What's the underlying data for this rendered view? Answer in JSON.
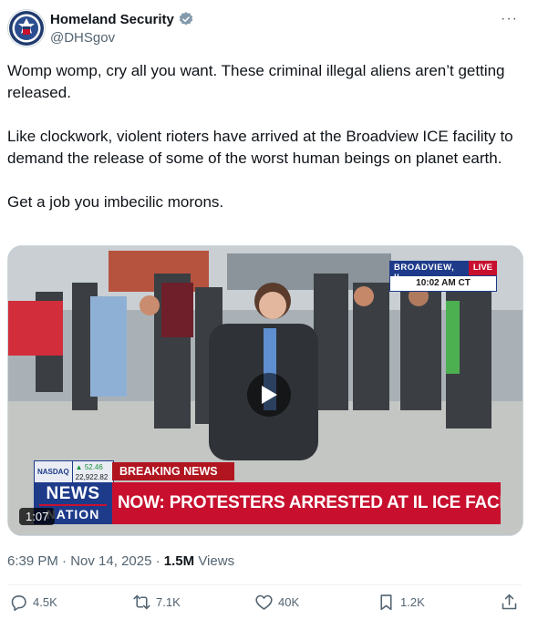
{
  "account": {
    "display_name": "Homeland Security",
    "handle": "@DHSgov",
    "verified_icon": "verified-badge-icon",
    "more_label": "···"
  },
  "tweet": {
    "paragraphs": [
      "Womp womp, cry all you want. These criminal illegal aliens aren’t getting released.",
      "Like clockwork, violent rioters have arrived at the Broadview ICE facility to demand the release of some of the worst human beings on planet earth.",
      "Get a job you imbecilic morons."
    ],
    "time": "6:39 PM",
    "date": "Nov 14, 2025",
    "separator": "·",
    "views_count": "1.5M",
    "views_label": "Views"
  },
  "video": {
    "duration": "1:07",
    "location": "BROADVIEW, IL",
    "live_label": "LIVE",
    "clock": "10:02 AM CT",
    "ticker_name": "NASDAQ",
    "ticker_change": "▲ 52.46",
    "ticker_value": "22,922.82",
    "breaking_label": "BREAKING NEWS",
    "logo_line1": "NEWS",
    "logo_line2": "NATION",
    "headline": "NOW: PROTESTERS ARRESTED AT IL ICE FACILITY"
  },
  "actions": {
    "replies": "4.5K",
    "reposts": "7.1K",
    "likes": "40K",
    "bookmarks": "1.2K"
  },
  "colors": {
    "text_primary": "#0f1419",
    "text_secondary": "#536471",
    "verified": "#829aab",
    "news_red": "#c8102e",
    "news_blue": "#1e3b8a"
  }
}
